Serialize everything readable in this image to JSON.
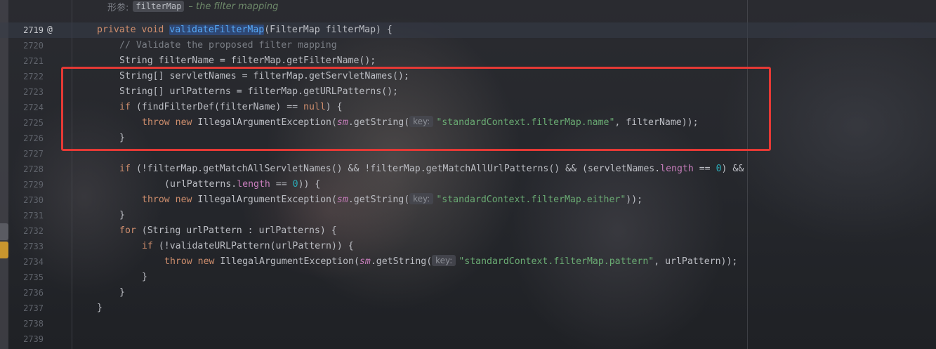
{
  "doc_hint": {
    "label": "形参:",
    "param": "filterMap",
    "desc": "– the filter mapping"
  },
  "gutter": {
    "override_icon": "at-override-icon"
  },
  "code": {
    "signature": {
      "ln": "2719",
      "private": "private",
      "void": "void",
      "name": "validateFilterMap",
      "rest": "(FilterMap filterMap) {"
    },
    "comment": {
      "ln": "2720",
      "text": "// Validate the proposed filter mapping"
    },
    "l2721": {
      "ln": "2721",
      "text": "String filterName = filterMap.getFilterName();"
    },
    "l2722": {
      "ln": "2722",
      "text": "String[] servletNames = filterMap.getServletNames();"
    },
    "l2723": {
      "ln": "2723",
      "text": "String[] urlPatterns = filterMap.getURLPatterns();"
    },
    "l2724": {
      "ln": "2724",
      "if": "if",
      "a": " (findFilterDef(filterName) == ",
      "null": "null",
      "b": ") {"
    },
    "l2725": {
      "ln": "2725",
      "throw": "throw",
      "new": "new",
      "a": " IllegalArgumentException(",
      "sm": "sm",
      "b": ".getString(",
      "hint": "key:",
      "str": "\"standardContext.filterMap.name\"",
      "c": ", filterName));"
    },
    "l2726": {
      "ln": "2726",
      "text": "}"
    },
    "l2727": {
      "ln": "2727"
    },
    "l2728": {
      "ln": "2728",
      "if": "if",
      "a": " (!filterMap.getMatchAllServletNames() && !filterMap.getMatchAllUrlPatterns() && (servletNames.",
      "length": "length",
      "b": " == ",
      "zero": "0",
      "c": ") &&"
    },
    "l2729": {
      "ln": "2729",
      "a": "(urlPatterns.",
      "length": "length",
      "b": " == ",
      "zero": "0",
      "c": ")) {"
    },
    "l2730": {
      "ln": "2730",
      "throw": "throw",
      "new": "new",
      "a": " IllegalArgumentException(",
      "sm": "sm",
      "b": ".getString(",
      "hint": "key:",
      "str": "\"standardContext.filterMap.either\"",
      "c": "));"
    },
    "l2731": {
      "ln": "2731",
      "text": "}"
    },
    "l2732": {
      "ln": "2732",
      "for": "for",
      "a": " (String urlPattern : urlPatterns) {"
    },
    "l2733": {
      "ln": "2733",
      "if": "if",
      "a": " (!validateURLPattern(urlPattern)) {"
    },
    "l2734": {
      "ln": "2734",
      "throw": "throw",
      "new": "new",
      "a": " IllegalArgumentException(",
      "sm": "sm",
      "b": ".getString(",
      "hint": "key:",
      "str": "\"standardContext.filterMap.pattern\"",
      "c": ", urlPattern));"
    },
    "l2735": {
      "ln": "2735",
      "text": "}"
    },
    "l2736": {
      "ln": "2736",
      "text": "}"
    },
    "l2737": {
      "ln": "2737",
      "text": "}"
    },
    "l2738": {
      "ln": "2738"
    },
    "l2739": {
      "ln": "2739"
    }
  },
  "colors": {
    "keyword": "#cf8e6d",
    "string": "#6aab73",
    "number": "#2aacb8",
    "method_decl": "#56a8f5",
    "field": "#c77dbb",
    "comment": "#7a7e85",
    "annotation_box": "#e53935"
  }
}
